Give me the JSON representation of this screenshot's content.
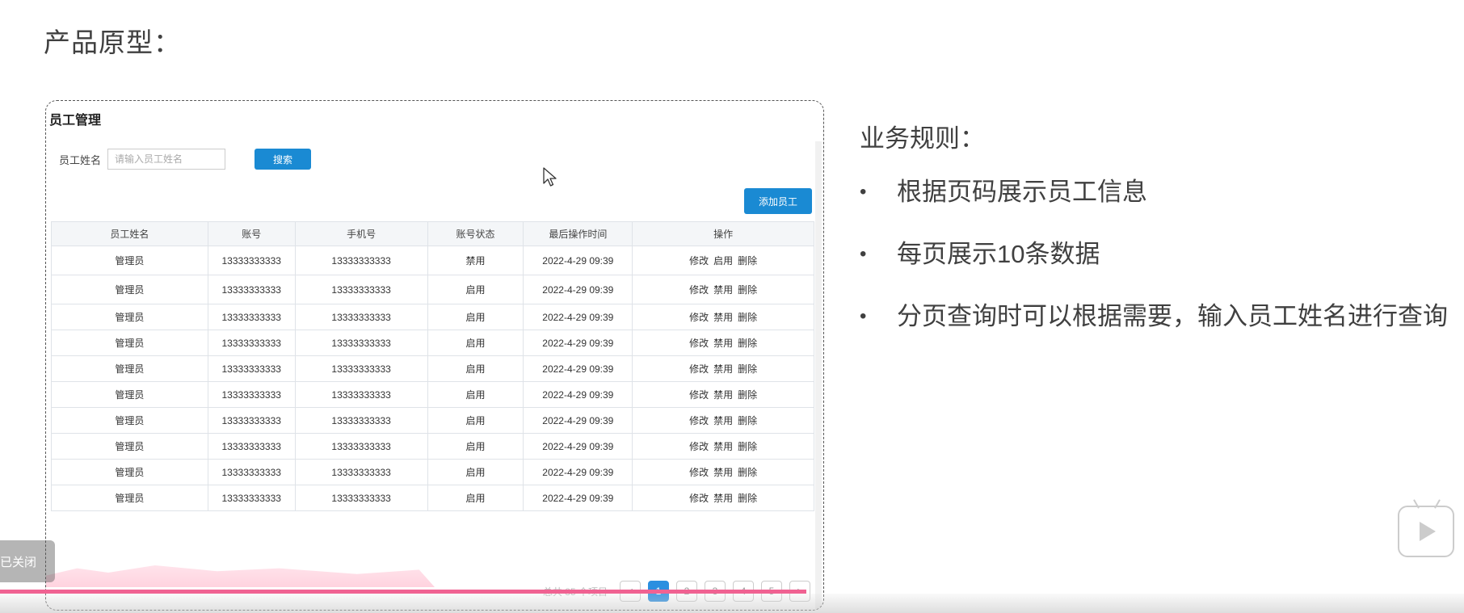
{
  "slide": {
    "title": "产品原型："
  },
  "prototype": {
    "panel_title": "员工管理",
    "search_label": "员工姓名",
    "search_placeholder": "请输入员工姓名",
    "search_button": "搜索",
    "add_button": "添加员工",
    "columns": [
      "员工姓名",
      "账号",
      "手机号",
      "账号状态",
      "最后操作时间",
      "操作"
    ],
    "rows": [
      {
        "name": "管理员",
        "account": "13333333333",
        "phone": "13333333333",
        "status": "禁用",
        "time": "2022-4-29 09:39",
        "ops": [
          "修改",
          "启用",
          "删除"
        ]
      },
      {
        "name": "管理员",
        "account": "13333333333",
        "phone": "13333333333",
        "status": "启用",
        "time": "2022-4-29 09:39",
        "ops": [
          "修改",
          "禁用",
          "删除"
        ]
      },
      {
        "name": "管理员",
        "account": "13333333333",
        "phone": "13333333333",
        "status": "启用",
        "time": "2022-4-29 09:39",
        "ops": [
          "修改",
          "禁用",
          "删除"
        ]
      },
      {
        "name": "管理员",
        "account": "13333333333",
        "phone": "13333333333",
        "status": "启用",
        "time": "2022-4-29 09:39",
        "ops": [
          "修改",
          "禁用",
          "删除"
        ]
      },
      {
        "name": "管理员",
        "account": "13333333333",
        "phone": "13333333333",
        "status": "启用",
        "time": "2022-4-29 09:39",
        "ops": [
          "修改",
          "禁用",
          "删除"
        ]
      },
      {
        "name": "管理员",
        "account": "13333333333",
        "phone": "13333333333",
        "status": "启用",
        "time": "2022-4-29 09:39",
        "ops": [
          "修改",
          "禁用",
          "删除"
        ]
      },
      {
        "name": "管理员",
        "account": "13333333333",
        "phone": "13333333333",
        "status": "启用",
        "time": "2022-4-29 09:39",
        "ops": [
          "修改",
          "禁用",
          "删除"
        ]
      },
      {
        "name": "管理员",
        "account": "13333333333",
        "phone": "13333333333",
        "status": "启用",
        "time": "2022-4-29 09:39",
        "ops": [
          "修改",
          "禁用",
          "删除"
        ]
      },
      {
        "name": "管理员",
        "account": "13333333333",
        "phone": "13333333333",
        "status": "启用",
        "time": "2022-4-29 09:39",
        "ops": [
          "修改",
          "禁用",
          "删除"
        ]
      },
      {
        "name": "管理员",
        "account": "13333333333",
        "phone": "13333333333",
        "status": "启用",
        "time": "2022-4-29 09:39",
        "ops": [
          "修改",
          "禁用",
          "删除"
        ]
      }
    ],
    "pager": {
      "total_text": "总共 85 个项目",
      "prev": "<",
      "next": ">",
      "pages": [
        "1",
        "2",
        "3",
        "4",
        "5"
      ],
      "active_page": "1"
    }
  },
  "rules": {
    "title": "业务规则：",
    "items": [
      "根据页码展示员工信息",
      "每页展示10条数据",
      "分页查询时可以根据需要，输入员工姓名进行查询"
    ]
  },
  "overlay": {
    "closed_badge": "已关闭"
  },
  "colors": {
    "primary_button": "#1a8ad3",
    "active_page": "#2b8fe0",
    "progress_line": "#f06292",
    "text": "#404040"
  },
  "icons": {
    "cursor": "mouse-cursor-icon",
    "player": "bilibili-tv-icon"
  }
}
